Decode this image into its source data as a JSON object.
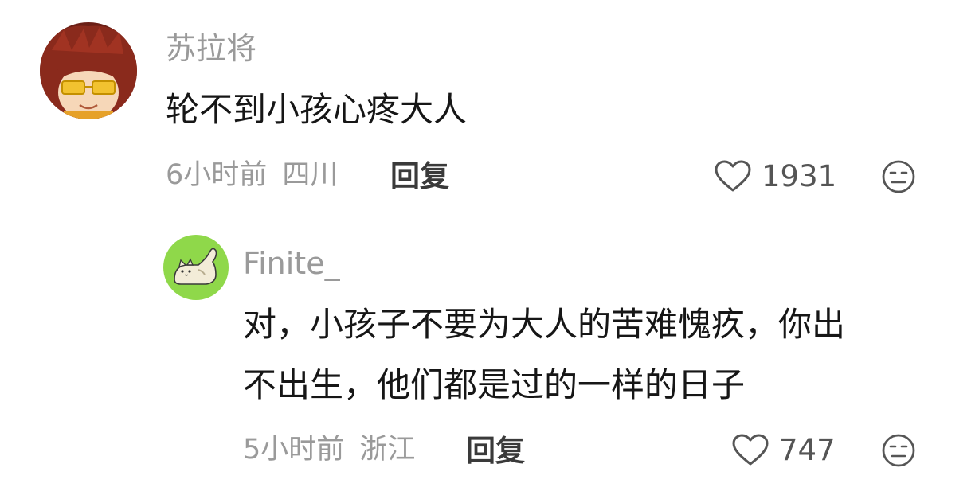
{
  "comments": [
    {
      "username": "苏拉将",
      "text_lines": [
        "轮不到小孩心疼大人"
      ],
      "time": "6小时前",
      "location": "四川",
      "reply_label": "回复",
      "likes": "1931",
      "avatar_icon": "anime-character-avatar",
      "is_reply": false
    },
    {
      "username": "Finite_",
      "text_lines": [
        "对，小孩子不要为大人的苦难愧疚，你出",
        "不出生，他们都是过的一样的日子"
      ],
      "time": "5小时前",
      "location": "浙江",
      "reply_label": "回复",
      "likes": "747",
      "avatar_icon": "cat-avatar",
      "is_reply": true
    }
  ],
  "colors": {
    "meta": "#9a9a9a",
    "text": "#161616",
    "reply": "#3a3a3a",
    "avatar2_bg": "#8fd84a"
  }
}
